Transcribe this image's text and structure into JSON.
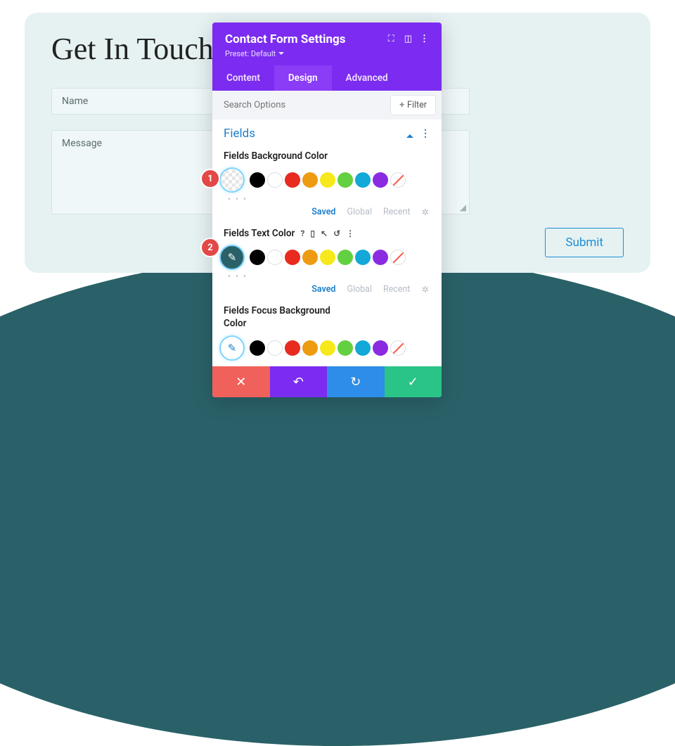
{
  "page": {
    "title": "Get In Touch",
    "name_placeholder": "Name",
    "message_placeholder": "Message",
    "submit_label": "Submit"
  },
  "panel": {
    "title": "Contact Form Settings",
    "preset_label": "Preset: Default",
    "tabs": {
      "content": "Content",
      "design": "Design",
      "advanced": "Advanced",
      "active": "design"
    },
    "search_placeholder": "Search Options",
    "filter_label": "Filter",
    "section_title": "Fields",
    "options": [
      {
        "key": "bg",
        "label": "Fields Background Color",
        "lead": "transparent",
        "show_tools": false,
        "badge": "1"
      },
      {
        "key": "text",
        "label": "Fields Text Color",
        "lead": "teal",
        "show_tools": true,
        "badge": "2"
      },
      {
        "key": "focus",
        "label": "Fields Focus Background Color",
        "lead": "white",
        "show_tools": false
      }
    ],
    "palette": [
      "#000000",
      "#ffffff",
      "#e82a1f",
      "#ed9b13",
      "#f7e81b",
      "#62d040",
      "#12a8d8",
      "#8a2be2",
      "diag"
    ],
    "history_tabs": {
      "saved": "Saved",
      "global": "Global",
      "recent": "Recent"
    }
  },
  "icons": {
    "expand": "⛶",
    "columns": "▯▯",
    "more": "⋮",
    "plus": "+",
    "help": "?",
    "device": "▯",
    "cursor": "↖",
    "undo": "↺",
    "close": "✕",
    "redo_left": "↶",
    "redo_right": "↻",
    "check": "✓",
    "gear": "✲",
    "dropper": "✎",
    "dots": "• • •"
  }
}
